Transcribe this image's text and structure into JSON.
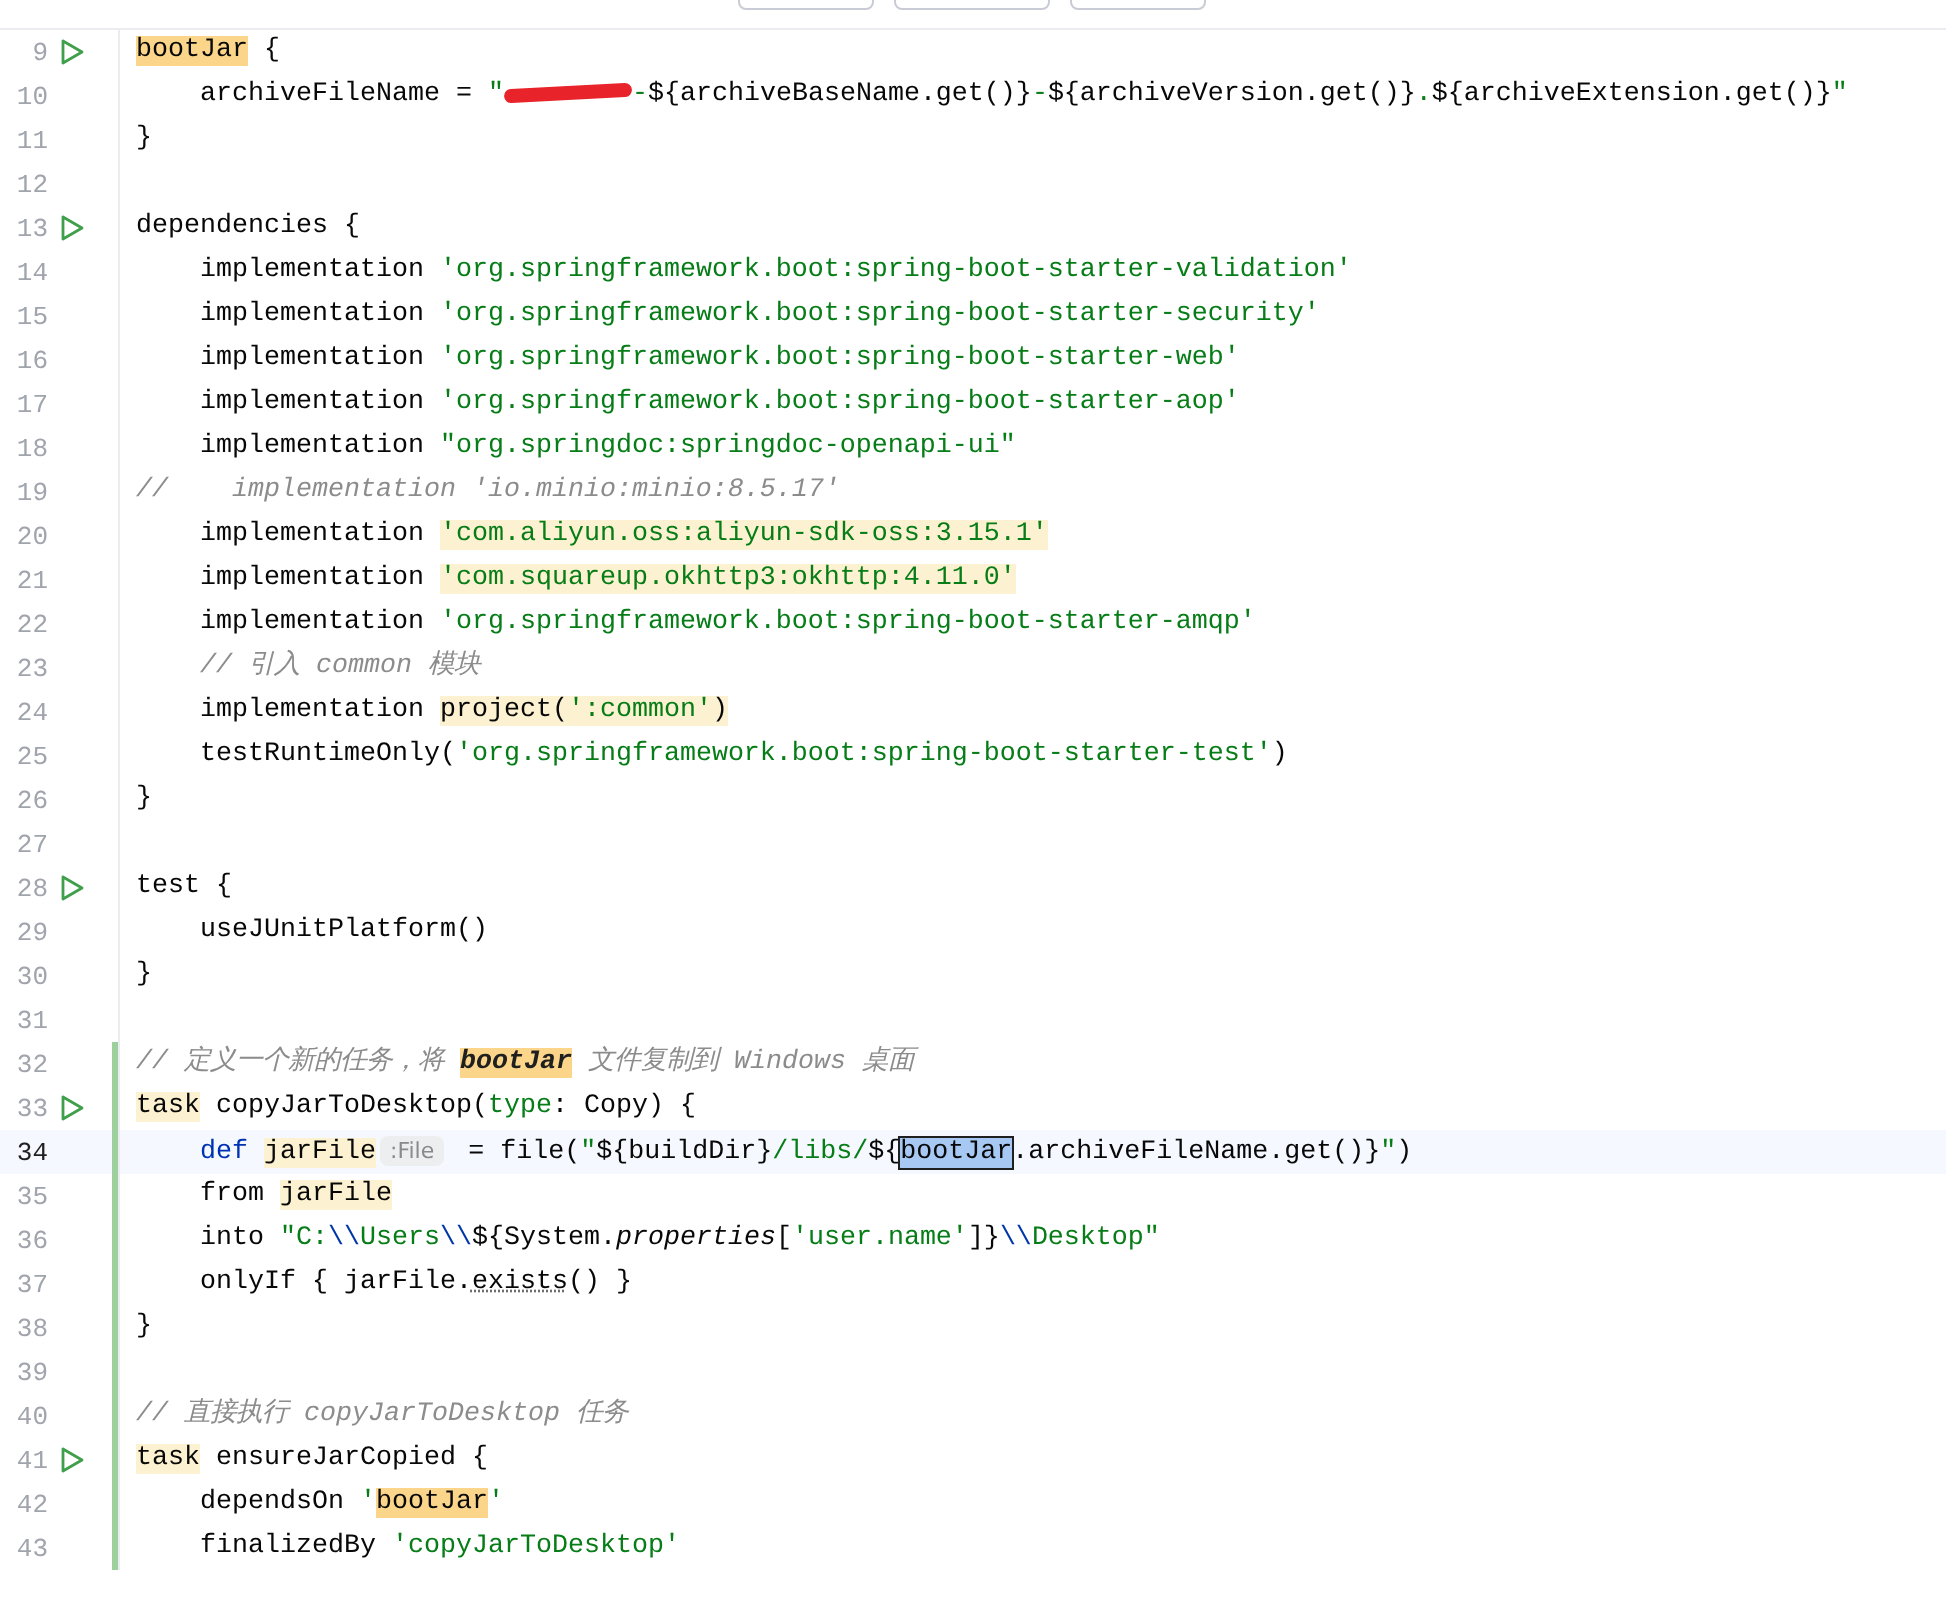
{
  "find_bar": {
    "buttons": [
      {
        "kind": "button"
      },
      {
        "kind": "button"
      },
      {
        "kind": "button"
      }
    ]
  },
  "lines": [
    {
      "num": "9",
      "run": true,
      "changed": false,
      "current": false,
      "tokens": [
        {
          "text": "bootJar",
          "kind": "plain",
          "write_highlight": true
        },
        {
          "text": " {",
          "kind": "plain"
        }
      ]
    },
    {
      "num": "10",
      "run": false,
      "changed": false,
      "current": false,
      "tokens": [
        {
          "text": "    archiveFileName = ",
          "kind": "plain"
        },
        {
          "text": "\"",
          "kind": "string"
        },
        {
          "kind": "redacted"
        },
        {
          "text": "-",
          "kind": "string"
        },
        {
          "text": "${archiveBaseName.get()}",
          "kind": "plain"
        },
        {
          "text": "-",
          "kind": "string"
        },
        {
          "text": "${archiveVersion.get()}",
          "kind": "plain"
        },
        {
          "text": ".",
          "kind": "string"
        },
        {
          "text": "${archiveExtension.get()}",
          "kind": "plain"
        },
        {
          "text": "\"",
          "kind": "string"
        }
      ]
    },
    {
      "num": "11",
      "run": false,
      "changed": false,
      "current": false,
      "tokens": [
        {
          "text": "}",
          "kind": "plain"
        }
      ]
    },
    {
      "num": "12",
      "run": false,
      "changed": false,
      "current": false
    },
    {
      "num": "13",
      "run": true,
      "changed": false,
      "current": false,
      "tokens": [
        {
          "text": "dependencies {",
          "kind": "plain"
        }
      ]
    },
    {
      "num": "14",
      "run": false,
      "changed": false,
      "current": false,
      "tokens": [
        {
          "text": "    implementation ",
          "kind": "plain"
        },
        {
          "text": "'org.springframework.boot:spring-boot-starter-validation'",
          "kind": "string"
        }
      ]
    },
    {
      "num": "15",
      "run": false,
      "changed": false,
      "current": false,
      "tokens": [
        {
          "text": "    implementation ",
          "kind": "plain"
        },
        {
          "text": "'org.springframework.boot:spring-boot-starter-security'",
          "kind": "string"
        }
      ]
    },
    {
      "num": "16",
      "run": false,
      "changed": false,
      "current": false,
      "tokens": [
        {
          "text": "    implementation ",
          "kind": "plain"
        },
        {
          "text": "'org.springframework.boot:spring-boot-starter-web'",
          "kind": "string"
        }
      ]
    },
    {
      "num": "17",
      "run": false,
      "changed": false,
      "current": false,
      "tokens": [
        {
          "text": "    implementation ",
          "kind": "plain"
        },
        {
          "text": "'org.springframework.boot:spring-boot-starter-aop'",
          "kind": "string"
        }
      ]
    },
    {
      "num": "18",
      "run": false,
      "changed": false,
      "current": false,
      "tokens": [
        {
          "text": "    implementation ",
          "kind": "plain"
        },
        {
          "text": "\"org.springdoc:springdoc-openapi-ui\"",
          "kind": "string"
        }
      ]
    },
    {
      "num": "19",
      "run": false,
      "changed": false,
      "current": false,
      "tokens": [
        {
          "text": "//    implementation 'io.minio:minio:8.5.17'",
          "kind": "comment"
        }
      ]
    },
    {
      "num": "20",
      "run": false,
      "changed": false,
      "current": false,
      "tokens": [
        {
          "text": "    implementation ",
          "kind": "plain"
        },
        {
          "text": "'com.aliyun.oss:aliyun-sdk-oss:3.15.1'",
          "kind": "string",
          "usage_highlight": true
        }
      ]
    },
    {
      "num": "21",
      "run": false,
      "changed": false,
      "current": false,
      "tokens": [
        {
          "text": "    implementation ",
          "kind": "plain"
        },
        {
          "text": "'com.squareup.okhttp3:okhttp:4.11.0'",
          "kind": "string",
          "usage_highlight": true
        }
      ]
    },
    {
      "num": "22",
      "run": false,
      "changed": false,
      "current": false,
      "tokens": [
        {
          "text": "    implementation ",
          "kind": "plain"
        },
        {
          "text": "'org.springframework.boot:spring-boot-starter-amqp'",
          "kind": "string"
        }
      ]
    },
    {
      "num": "23",
      "run": false,
      "changed": false,
      "current": false,
      "tokens": [
        {
          "text": "    // 引入 common 模块",
          "kind": "comment"
        }
      ]
    },
    {
      "num": "24",
      "run": false,
      "changed": false,
      "current": false,
      "tokens": [
        {
          "text": "    implementation ",
          "kind": "plain"
        },
        {
          "text": "project(",
          "kind": "plain",
          "usage_highlight": true
        },
        {
          "text": "':common'",
          "kind": "string",
          "usage_highlight": true
        },
        {
          "text": ")",
          "kind": "plain",
          "usage_highlight": true
        }
      ]
    },
    {
      "num": "25",
      "run": false,
      "changed": false,
      "current": false,
      "tokens": [
        {
          "text": "    testRuntimeOnly(",
          "kind": "plain"
        },
        {
          "text": "'org.springframework.boot:spring-boot-starter-test'",
          "kind": "string"
        },
        {
          "text": ")",
          "kind": "plain"
        }
      ]
    },
    {
      "num": "26",
      "run": false,
      "changed": false,
      "current": false,
      "tokens": [
        {
          "text": "}",
          "kind": "plain"
        }
      ]
    },
    {
      "num": "27",
      "run": false,
      "changed": false,
      "current": false
    },
    {
      "num": "28",
      "run": true,
      "changed": false,
      "current": false,
      "tokens": [
        {
          "text": "test {",
          "kind": "plain"
        }
      ]
    },
    {
      "num": "29",
      "run": false,
      "changed": false,
      "current": false,
      "tokens": [
        {
          "text": "    useJUnitPlatform()",
          "kind": "plain"
        }
      ]
    },
    {
      "num": "30",
      "run": false,
      "changed": false,
      "current": false,
      "tokens": [
        {
          "text": "}",
          "kind": "plain"
        }
      ]
    },
    {
      "num": "31",
      "run": false,
      "changed": false,
      "current": false
    },
    {
      "num": "32",
      "run": false,
      "changed": true,
      "current": false,
      "tokens": [
        {
          "text": "// 定义一个新的任务，将 ",
          "kind": "comment"
        },
        {
          "text": "bootJar",
          "kind": "comment_reference",
          "write_highlight": true
        },
        {
          "text": " 文件复制到 Windows 桌面",
          "kind": "comment"
        }
      ]
    },
    {
      "num": "33",
      "run": true,
      "changed": true,
      "current": false,
      "tokens": [
        {
          "text": "task",
          "kind": "plain",
          "usage_highlight": true
        },
        {
          "text": " copyJarToDesktop(",
          "kind": "plain"
        },
        {
          "text": "type",
          "kind": "parameter"
        },
        {
          "text": ": Copy) {",
          "kind": "plain"
        }
      ]
    },
    {
      "num": "34",
      "run": false,
      "changed": true,
      "current": true,
      "tokens": [
        {
          "text": "    def ",
          "kind": "keyword"
        },
        {
          "text": "jarFile",
          "kind": "plain",
          "usage_highlight": true
        },
        {
          "text": ":File",
          "kind": "hint"
        },
        {
          "text": " = file(",
          "kind": "plain"
        },
        {
          "text": "\"",
          "kind": "string"
        },
        {
          "text": "${buildDir}",
          "kind": "plain"
        },
        {
          "text": "/libs/",
          "kind": "string"
        },
        {
          "text": "${",
          "kind": "plain"
        },
        {
          "text": "bootJar",
          "kind": "plain",
          "selected": true
        },
        {
          "text": ".archiveFileName.get()}",
          "kind": "plain"
        },
        {
          "text": "\"",
          "kind": "string"
        },
        {
          "text": ")",
          "kind": "plain"
        }
      ]
    },
    {
      "num": "35",
      "run": false,
      "changed": true,
      "current": false,
      "tokens": [
        {
          "text": "    from ",
          "kind": "plain"
        },
        {
          "text": "jarFile",
          "kind": "plain",
          "usage_highlight": true
        }
      ]
    },
    {
      "num": "36",
      "run": false,
      "changed": true,
      "current": false,
      "tokens": [
        {
          "text": "    into ",
          "kind": "plain"
        },
        {
          "text": "\"C:",
          "kind": "string"
        },
        {
          "text": "\\\\",
          "kind": "escape"
        },
        {
          "text": "Users",
          "kind": "string"
        },
        {
          "text": "\\\\",
          "kind": "escape"
        },
        {
          "text": "${System.",
          "kind": "plain"
        },
        {
          "text": "properties",
          "kind": "static"
        },
        {
          "text": "[",
          "kind": "plain"
        },
        {
          "text": "'user.name'",
          "kind": "string"
        },
        {
          "text": "]}",
          "kind": "plain"
        },
        {
          "text": "\\\\",
          "kind": "escape"
        },
        {
          "text": "Desktop\"",
          "kind": "string"
        }
      ]
    },
    {
      "num": "37",
      "run": false,
      "changed": true,
      "current": false,
      "tokens": [
        {
          "text": "    onlyIf { jarFile.",
          "kind": "plain"
        },
        {
          "text": "exists",
          "kind": "warning"
        },
        {
          "text": "() }",
          "kind": "plain"
        }
      ]
    },
    {
      "num": "38",
      "run": false,
      "changed": true,
      "current": false,
      "tokens": [
        {
          "text": "}",
          "kind": "plain"
        }
      ]
    },
    {
      "num": "39",
      "run": false,
      "changed": true,
      "current": false
    },
    {
      "num": "40",
      "run": false,
      "changed": true,
      "current": false,
      "tokens": [
        {
          "text": "// 直接执行 copyJarToDesktop 任务",
          "kind": "comment"
        }
      ]
    },
    {
      "num": "41",
      "run": true,
      "changed": true,
      "current": false,
      "tokens": [
        {
          "text": "task",
          "kind": "plain",
          "usage_highlight": true
        },
        {
          "text": " ensureJarCopied {",
          "kind": "plain"
        }
      ]
    },
    {
      "num": "42",
      "run": false,
      "changed": true,
      "current": false,
      "tokens": [
        {
          "text": "    dependsOn ",
          "kind": "plain"
        },
        {
          "text": "'",
          "kind": "string"
        },
        {
          "text": "bootJar",
          "kind": "plain",
          "write_highlight": true
        },
        {
          "text": "'",
          "kind": "string"
        }
      ]
    },
    {
      "num": "43",
      "run": false,
      "changed": true,
      "current": false,
      "tokens": [
        {
          "text": "    finalizedBy ",
          "kind": "plain"
        },
        {
          "text": "'copyJarToDesktop'",
          "kind": "string"
        }
      ]
    }
  ]
}
